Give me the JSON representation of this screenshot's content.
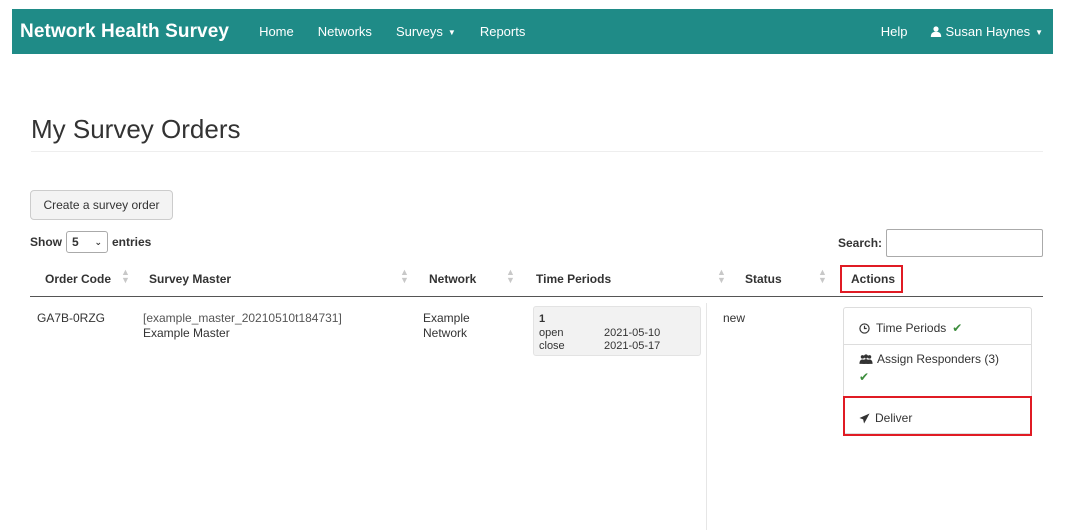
{
  "navbar": {
    "brand": "Network Health Survey",
    "links": [
      "Home",
      "Networks",
      "Surveys",
      "Reports"
    ],
    "help": "Help",
    "user": "Susan Haynes",
    "color": "#1f8b87"
  },
  "page": {
    "title": "My Survey Orders"
  },
  "toolbar": {
    "create_label": "Create a survey order"
  },
  "table_controls": {
    "show_label": "Show",
    "entries_value": "5",
    "entries_label": "entries",
    "search_label": "Search:",
    "search_value": ""
  },
  "table": {
    "columns": [
      "Order Code",
      "Survey Master",
      "Network",
      "Time Periods",
      "Status",
      "Actions"
    ],
    "rows": [
      {
        "order_code": "GA7B-0RZG",
        "survey_master_id": "[example_master_20210510t184731]",
        "survey_master_name": "Example Master",
        "network_line1": "Example",
        "network_line2": "Network",
        "time_period": {
          "number": "1",
          "open_label": "open",
          "open_date": "2021-05-10",
          "close_label": "close",
          "close_date": "2021-05-17"
        },
        "status": "new",
        "actions": {
          "time_periods": "Time Periods",
          "assign_responders": "Assign Responders (3)",
          "deliver": "Deliver"
        }
      }
    ]
  },
  "highlight_color": "#e01b24",
  "check_color": "#3c8d3c"
}
